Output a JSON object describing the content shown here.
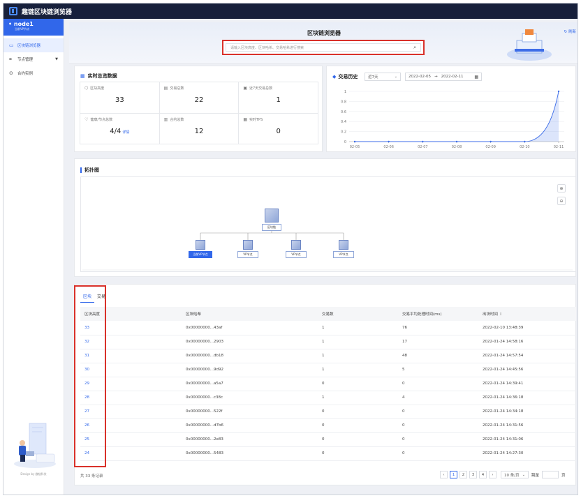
{
  "app": {
    "title": "趣链区块链浏览器"
  },
  "sidebar": {
    "node_name": "node1",
    "node_sub": "当前VP节点",
    "items": [
      {
        "label": "区块链浏览器",
        "icon": "monitor-icon",
        "active": true
      },
      {
        "label": "节点管理",
        "icon": "nodes-icon",
        "has_arrow": true
      },
      {
        "label": "合约实例",
        "icon": "contract-icon"
      }
    ],
    "illustration_caption": "Design by 趣链科技"
  },
  "banner": {
    "title": "区块链浏览器",
    "search_placeholder": "请输入区块高度、区块哈希、交易哈希进行搜索",
    "refresh_label": "刷新"
  },
  "overview": {
    "title": "实时总览数据",
    "stats": [
      {
        "label": "区块高度",
        "value": "33",
        "icon": "block-icon"
      },
      {
        "label": "交易总数",
        "value": "22",
        "icon": "document-icon"
      },
      {
        "label": "近7天交易总数",
        "value": "1",
        "icon": "calendar-icon"
      },
      {
        "label": "健康/节点总数",
        "value": "4/4",
        "icon": "health-icon",
        "detail": "详情"
      },
      {
        "label": "合约总数",
        "value": "12",
        "icon": "contract-icon"
      },
      {
        "label": "实时TPS",
        "value": "0",
        "icon": "speed-icon"
      }
    ]
  },
  "history": {
    "title": "交易历史",
    "range_select": "近7天",
    "date_from": "2022-02-05",
    "date_to": "2022-02-11"
  },
  "chart_data": {
    "type": "area",
    "categories": [
      "02-05",
      "02-06",
      "02-07",
      "02-08",
      "02-09",
      "02-10",
      "02-11"
    ],
    "values": [
      0,
      0,
      0,
      0,
      0,
      0,
      1
    ],
    "yticks": [
      "0",
      "0.2",
      "0.4",
      "0.6",
      "0.8",
      "1"
    ],
    "ylim": [
      0,
      1
    ],
    "color": "#3d6de8"
  },
  "topology": {
    "title": "拓扑图",
    "root_label": "区块链",
    "nodes": [
      {
        "label": "当前VP节点",
        "selected": true
      },
      {
        "label": "VP节点"
      },
      {
        "label": "VP节点"
      },
      {
        "label": "VP节点"
      }
    ]
  },
  "blocks": {
    "tabs": [
      "区块",
      "交易"
    ],
    "columns": [
      "区块高度",
      "区块哈希",
      "交易数",
      "交易平均处理时间(ms)",
      "出块时间"
    ],
    "rows": [
      {
        "height": "33",
        "hash": "0x00000000...43af",
        "tx": "1",
        "avg": "76",
        "time": "2022-02-10 13:48:39"
      },
      {
        "height": "32",
        "hash": "0x00000000...2903",
        "tx": "1",
        "avg": "17",
        "time": "2022-01-24 14:58:16"
      },
      {
        "height": "31",
        "hash": "0x00000000...db18",
        "tx": "1",
        "avg": "48",
        "time": "2022-01-24 14:57:54"
      },
      {
        "height": "30",
        "hash": "0x00000000...9d92",
        "tx": "1",
        "avg": "5",
        "time": "2022-01-24 14:45:56"
      },
      {
        "height": "29",
        "hash": "0x00000000...a5a7",
        "tx": "0",
        "avg": "0",
        "time": "2022-01-24 14:39:41"
      },
      {
        "height": "28",
        "hash": "0x00000000...c38c",
        "tx": "1",
        "avg": "4",
        "time": "2022-01-24 14:36:18"
      },
      {
        "height": "27",
        "hash": "0x00000000...522f",
        "tx": "0",
        "avg": "0",
        "time": "2022-01-24 14:34:18"
      },
      {
        "height": "26",
        "hash": "0x00000000...d7b6",
        "tx": "0",
        "avg": "0",
        "time": "2022-01-24 14:31:56"
      },
      {
        "height": "25",
        "hash": "0x00000000...2e83",
        "tx": "0",
        "avg": "0",
        "time": "2022-01-24 14:31:06"
      },
      {
        "height": "24",
        "hash": "0x00000000...5483",
        "tx": "0",
        "avg": "0",
        "time": "2022-01-24 14:27:30"
      }
    ],
    "total_text": "共 33 条记录",
    "pages": [
      "1",
      "2",
      "3",
      "4"
    ],
    "page_size": "10 条/页",
    "goto_label": "跳至",
    "page_unit": "页"
  }
}
